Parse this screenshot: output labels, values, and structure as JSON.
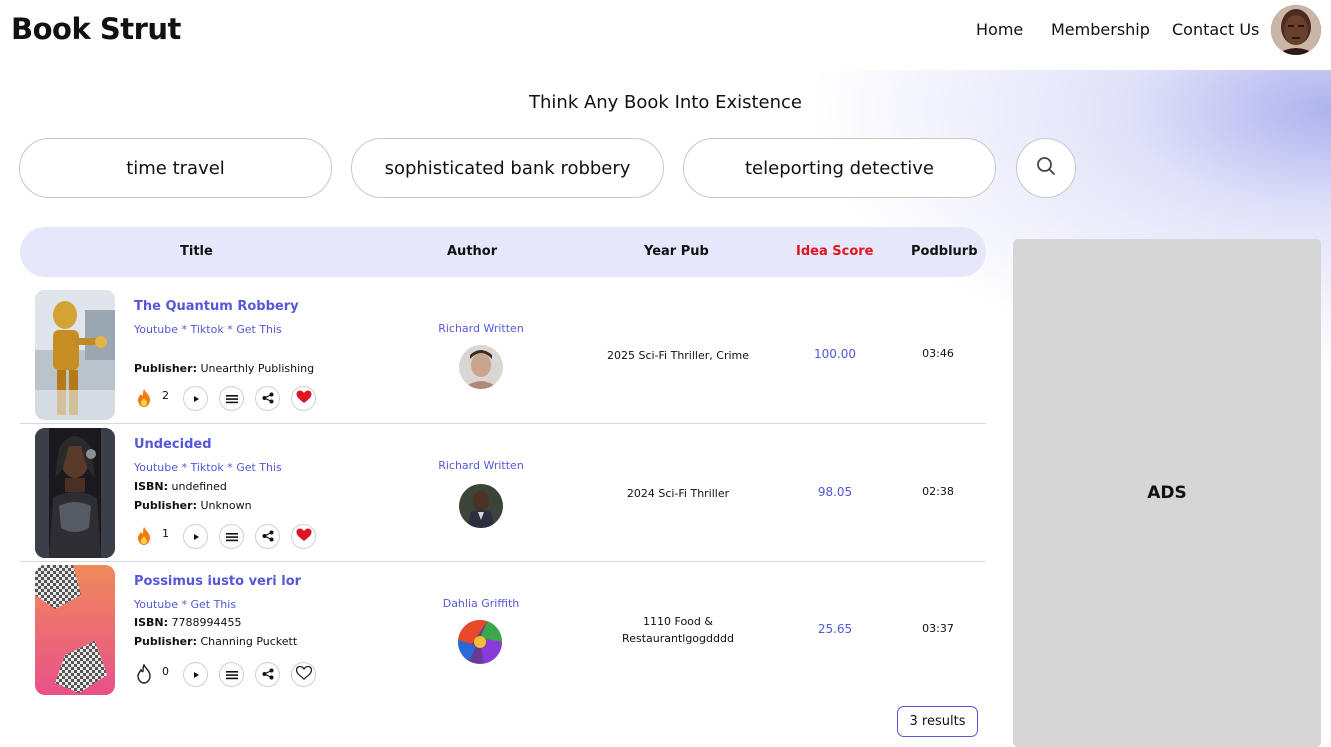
{
  "header": {
    "brand": "Book Strut",
    "nav": [
      "Home",
      "Membership",
      "Contact Us"
    ]
  },
  "tagline": "Think Any Book Into Existence",
  "prompts": [
    "time travel",
    "sophisticated bank robbery",
    "teleporting detective"
  ],
  "table": {
    "columns": [
      "Title",
      "Author",
      "Year Pub",
      "Idea Score",
      "Podblurb"
    ],
    "rows": [
      {
        "title": "The Quantum Robbery",
        "links": "Youtube * Tiktok * Get This",
        "isbn_label": "",
        "isbn": "",
        "publisher_label": "Publisher:",
        "publisher": "Unearthly Publishing",
        "fire_count": "2",
        "liked": true,
        "author": "Richard Written",
        "year_genre": "2025 Sci-Fi Thriller, Crime",
        "score": "100.00",
        "podblurb": "03:46"
      },
      {
        "title": "Undecided",
        "links": "Youtube * Tiktok * Get This",
        "isbn_label": "ISBN:",
        "isbn": "undefined",
        "publisher_label": "Publisher:",
        "publisher": "Unknown",
        "fire_count": "1",
        "liked": true,
        "author": "Richard Written",
        "year_genre": "2024 Sci-Fi Thriller",
        "score": "98.05",
        "podblurb": "02:38"
      },
      {
        "title": "Possimus iusto veri lor",
        "links": "Youtube * Get This",
        "isbn_label": "ISBN:",
        "isbn": "7788994455",
        "publisher_label": "Publisher:",
        "publisher": "Channing Puckett",
        "fire_count": "0",
        "liked": false,
        "author": "Dahlia Griffith",
        "year_genre_line1": "1110 Food &",
        "year_genre_line2": "Restaurantlgogdddd",
        "score": "25.65",
        "podblurb": "03:37"
      }
    ]
  },
  "results_label": "3 results",
  "ads_label": "ADS",
  "colors": {
    "accent": "#5558d8",
    "idea_score_header": "#e0141e",
    "heart": "#e0141e",
    "fire": "#f27a12",
    "table_header_bg": "#e6e7fa",
    "ads_bg": "#d6d6d6"
  },
  "icons": [
    "search-icon",
    "fire-icon",
    "play-icon",
    "menu-icon",
    "share-icon",
    "heart-icon"
  ]
}
